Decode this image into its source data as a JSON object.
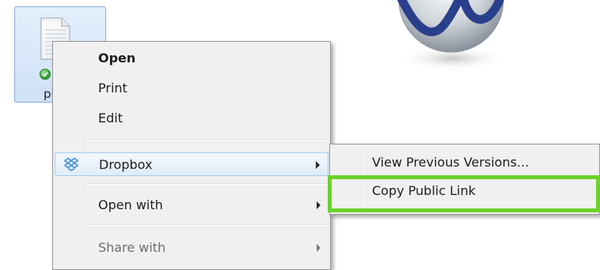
{
  "desktop": {
    "file_name": "plat"
  },
  "context_menu": {
    "items": [
      {
        "label": "Open"
      },
      {
        "label": "Print"
      },
      {
        "label": "Edit"
      },
      {
        "label": "Dropbox"
      },
      {
        "label": "Open with"
      },
      {
        "label": "Share with"
      }
    ]
  },
  "dropbox_submenu": {
    "items": [
      {
        "label": "View Previous Versions..."
      },
      {
        "label": "Copy Public Link"
      }
    ]
  },
  "colors": {
    "highlight_outline": "#6ad22a",
    "selection_bg": "#cfe1f7",
    "dropbox_blue": "#3d8fd6"
  }
}
